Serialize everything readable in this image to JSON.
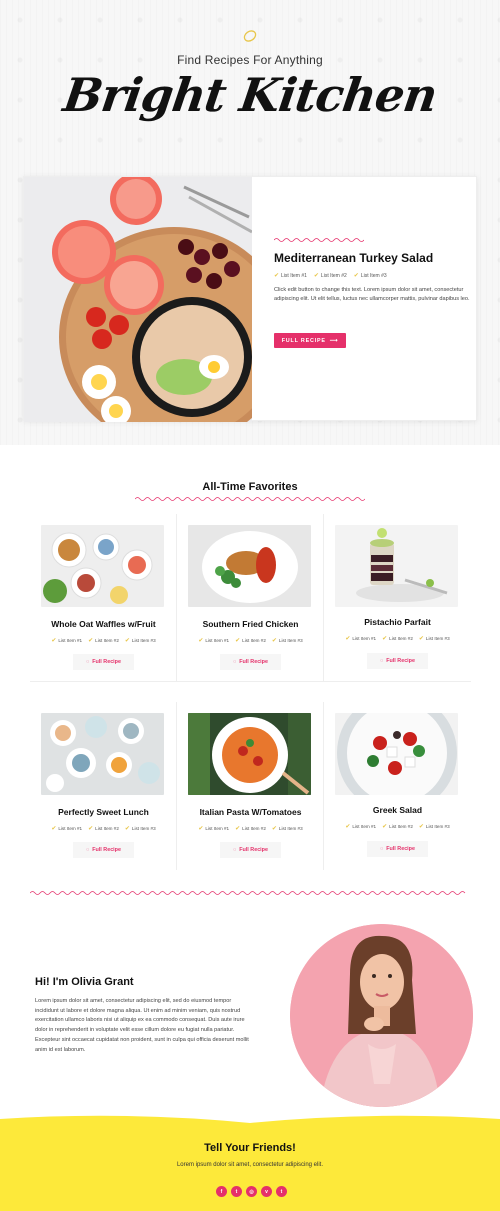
{
  "hero": {
    "tagline": "Find Recipes For Anything",
    "brand": "Bright Kitchen",
    "feature": {
      "title": "Mediterranean Turkey Salad",
      "list": [
        "List Item #1",
        "List Item #2",
        "List Item #3"
      ],
      "text": "Click edit button to change this text. Lorem ipsum dolor sit amet, consectetur adipiscing elit. Ut elit tellus, luctus nec ullamcorper mattis, pulvinar dapibus leo.",
      "button": "FULL RECIPE"
    }
  },
  "favorites": {
    "title": "All-Time Favorites",
    "recipes": [
      {
        "name": "Whole Oat Waffles w/Fruit",
        "items": [
          "List Item #1",
          "List Item #2",
          "List Item #3"
        ],
        "button": "Full Recipe"
      },
      {
        "name": "Southern Fried Chicken",
        "items": [
          "List Item #1",
          "List Item #2",
          "List Item #3"
        ],
        "button": "Full Recipe"
      },
      {
        "name": "Pistachio Parfait",
        "items": [
          "List Item #1",
          "List Item #2",
          "List Item #3"
        ],
        "button": "Full Recipe"
      },
      {
        "name": "Perfectly Sweet Lunch",
        "items": [
          "List Item #1",
          "List Item #2",
          "List Item #3"
        ],
        "button": "Full Recipe"
      },
      {
        "name": "Italian Pasta W/Tomatoes",
        "items": [
          "List Item #1",
          "List Item #2",
          "List Item #3"
        ],
        "button": "Full Recipe"
      },
      {
        "name": "Greek Salad",
        "items": [
          "List Item #1",
          "List Item #2",
          "List Item #3"
        ],
        "button": "Full Recipe"
      }
    ]
  },
  "about": {
    "heading": "Hi! I'm Olivia Grant",
    "text": "Lorem ipsum dolor sit amet, consectetur adipiscing elit, sed do eiusmod tempor incididunt ut labore et dolore magna aliqua. Ut enim ad minim veniam, quis nostrud exercitation ullamco laboris nisi ut aliquip ex ea commodo consequat. Duis aute irure dolor in reprehenderit in voluptate velit esse cillum dolore eu fugiat nulla pariatur. Excepteur sint occaecat cupidatat non proident, sunt in culpa qui officia deserunt mollit anim id est laborum."
  },
  "footer": {
    "title": "Tell Your Friends!",
    "text": "Lorem ipsum dolor sit amet, consectetur adipiscing elit.",
    "socials": [
      {
        "icon": "facebook-icon",
        "glyph": "f"
      },
      {
        "icon": "twitter-icon",
        "glyph": "t"
      },
      {
        "icon": "instagram-icon",
        "glyph": "◎"
      },
      {
        "icon": "vimeo-icon",
        "glyph": "v"
      },
      {
        "icon": "tumblr-icon",
        "glyph": "t"
      }
    ]
  },
  "colors": {
    "accent": "#e5306a",
    "yellow": "#fde93a",
    "bullet": "#e8c64a"
  }
}
